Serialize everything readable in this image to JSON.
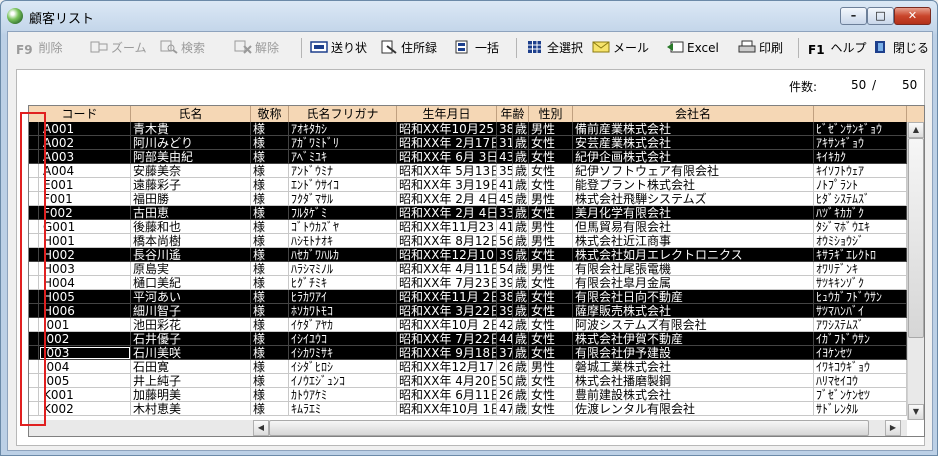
{
  "window": {
    "title": "顧客リスト",
    "minimize": "–",
    "maximize": "□",
    "close": "✕"
  },
  "toolbar": {
    "delete_key": "F9",
    "delete": "削除",
    "zoom": "ズーム",
    "search": "検索",
    "release": "解除",
    "invoice": "送り状",
    "address_book": "住所録",
    "batch": "一括",
    "select_all": "全選択",
    "mail": "メール",
    "excel": "Excel",
    "print": "印刷",
    "help_key": "F1",
    "help": "ヘルプ",
    "close": "閉じる"
  },
  "count": {
    "label": "件数:",
    "current": "50",
    "slash": "/",
    "total": "50"
  },
  "columns": [
    "コード",
    "氏名",
    "敬称",
    "氏名フリガナ",
    "生年月日",
    "年齢",
    "性別",
    "会社名",
    ""
  ],
  "rows": [
    {
      "code": "A001",
      "name": "青木貴",
      "honorific": "様",
      "kana": "ｱｵｷﾀｶｼ",
      "birth": "昭和XX年10月25日",
      "age": "38",
      "unit": "歳",
      "gender": "男性",
      "company": "備前産業株式会社",
      "company_kana": "ﾋﾞｾﾞﾝｻﾝｷﾞｮｳ",
      "selected": true
    },
    {
      "code": "A002",
      "name": "阿川みどり",
      "honorific": "様",
      "kana": "ｱｶﾞﾜﾐﾄﾞﾘ",
      "birth": "昭和XX年 2月17日",
      "age": "31",
      "unit": "歳",
      "gender": "女性",
      "company": "安芸産業株式会社",
      "company_kana": "ｱｷｻﾝｷﾞｮｳ",
      "selected": true
    },
    {
      "code": "A003",
      "name": "阿部美由紀",
      "honorific": "様",
      "kana": "ｱﾍﾞﾐﾕｷ",
      "birth": "昭和XX年 6月 3日",
      "age": "43",
      "unit": "歳",
      "gender": "女性",
      "company": "紀伊企画株式会社",
      "company_kana": "ｷｲｷｶｸ",
      "selected": true
    },
    {
      "code": "A004",
      "name": "安藤美奈",
      "honorific": "様",
      "kana": "ｱﾝﾄﾞｳﾐﾅ",
      "birth": "昭和XX年 5月13日",
      "age": "35",
      "unit": "歳",
      "gender": "女性",
      "company": "紀伊ソフトウェア有限会社",
      "company_kana": "ｷｲｿﾌﾄｳｪｱ",
      "selected": false
    },
    {
      "code": "E001",
      "name": "遠藤彩子",
      "honorific": "様",
      "kana": "ｴﾝﾄﾞｳｻｲｺ",
      "birth": "昭和XX年 3月19日",
      "age": "41",
      "unit": "歳",
      "gender": "女性",
      "company": "能登プラント株式会社",
      "company_kana": "ﾉﾄﾌﾟﾗﾝﾄ",
      "selected": false
    },
    {
      "code": "F001",
      "name": "福田勝",
      "honorific": "様",
      "kana": "ﾌｸﾀﾞﾏｻﾙ",
      "birth": "昭和XX年 2月 4日",
      "age": "45",
      "unit": "歳",
      "gender": "男性",
      "company": "株式会社飛騨システムズ",
      "company_kana": "ﾋﾀﾞｼｽﾃﾑｽﾞ",
      "selected": false
    },
    {
      "code": "F002",
      "name": "古田恵",
      "honorific": "様",
      "kana": "ﾌﾙﾀｹﾞﾐ",
      "birth": "昭和XX年 2月 4日",
      "age": "33",
      "unit": "歳",
      "gender": "女性",
      "company": "美月化学有限会社",
      "company_kana": "ﾊﾂﾞｷｶｶﾞｸ",
      "selected": true
    },
    {
      "code": "G001",
      "name": "後藤和也",
      "honorific": "様",
      "kana": "ｺﾞﾄｳｶｽﾞﾔ",
      "birth": "昭和XX年11月23日",
      "age": "41",
      "unit": "歳",
      "gender": "男性",
      "company": "但馬貿易有限会社",
      "company_kana": "ﾀｼﾞﾏﾎﾞｳｴｷ",
      "selected": false
    },
    {
      "code": "H001",
      "name": "橋本尚樹",
      "honorific": "様",
      "kana": "ﾊｼﾓﾄﾅｵｷ",
      "birth": "昭和XX年 8月12日",
      "age": "56",
      "unit": "歳",
      "gender": "男性",
      "company": "株式会社近江商事",
      "company_kana": "ｵｳﾐｼｮｳｼﾞ",
      "selected": false
    },
    {
      "code": "H002",
      "name": "長谷川遙",
      "honorific": "様",
      "kana": "ﾊｾｶﾞﾜﾊﾙｶ",
      "birth": "昭和XX年12月10日",
      "age": "39",
      "unit": "歳",
      "gender": "女性",
      "company": "株式会社如月エレクトロニクス",
      "company_kana": "ｷｻﾗｷﾞｴﾚｸﾄﾛ",
      "selected": true
    },
    {
      "code": "H003",
      "name": "原島実",
      "honorific": "様",
      "kana": "ﾊﾗｼﾏﾐﾉﾙ",
      "birth": "昭和XX年 4月11日",
      "age": "54",
      "unit": "歳",
      "gender": "男性",
      "company": "有限会社尾張電機",
      "company_kana": "ｵﾜﾘﾃﾞﾝｷ",
      "selected": false
    },
    {
      "code": "H004",
      "name": "樋口美紀",
      "honorific": "様",
      "kana": "ﾋｸﾞﾁﾐｷ",
      "birth": "昭和XX年 7月23日",
      "age": "39",
      "unit": "歳",
      "gender": "女性",
      "company": "有限会社皐月金属",
      "company_kana": "ｻﾂｷｷﾝｿﾞｸ",
      "selected": false
    },
    {
      "code": "H005",
      "name": "平河あい",
      "honorific": "様",
      "kana": "ﾋﾗｶﾜｱｲ",
      "birth": "昭和XX年11月 2日",
      "age": "38",
      "unit": "歳",
      "gender": "女性",
      "company": "有限会社日向不動産",
      "company_kana": "ﾋｭｳｶﾞﾌﾄﾞｳｻﾝ",
      "selected": true
    },
    {
      "code": "H006",
      "name": "細川智子",
      "honorific": "様",
      "kana": "ﾎｿｶﾜﾄﾓｺ",
      "birth": "昭和XX年 3月22日",
      "age": "39",
      "unit": "歳",
      "gender": "女性",
      "company": "薩摩販売株式会社",
      "company_kana": "ｻﾂﾏﾊﾝﾊﾞｲ",
      "selected": true
    },
    {
      "code": "I001",
      "name": "池田彩花",
      "honorific": "様",
      "kana": "ｲｹﾀﾞｱﾔｶ",
      "birth": "昭和XX年10月 2日",
      "age": "42",
      "unit": "歳",
      "gender": "女性",
      "company": "阿波システムズ有限会社",
      "company_kana": "ｱﾜｼｽﾃﾑｽﾞ",
      "selected": false
    },
    {
      "code": "I002",
      "name": "石井優子",
      "honorific": "様",
      "kana": "ｲｼｲﾕｳｺ",
      "birth": "昭和XX年 7月22日",
      "age": "44",
      "unit": "歳",
      "gender": "女性",
      "company": "株式会社伊賀不動産",
      "company_kana": "ｲｶﾞﾌﾄﾞｳｻﾝ",
      "selected": true
    },
    {
      "code": "I003",
      "name": "石川美咲",
      "honorific": "様",
      "kana": "ｲｼｶﾜﾐｻｷ",
      "birth": "昭和XX年 9月18日",
      "age": "37",
      "unit": "歳",
      "gender": "女性",
      "company": "有限会社伊予建設",
      "company_kana": "ｲﾖｹﾝｾﾂ",
      "selected": true,
      "focused": true
    },
    {
      "code": "I004",
      "name": "石田寛",
      "honorific": "様",
      "kana": "ｲｼﾀﾞﾋﾛｼ",
      "birth": "昭和XX年12月17日",
      "age": "26",
      "unit": "歳",
      "gender": "男性",
      "company": "磐城工業株式会社",
      "company_kana": "ｲﾜｷｺｳｷﾞｮｳ",
      "selected": false
    },
    {
      "code": "I005",
      "name": "井上純子",
      "honorific": "様",
      "kana": "ｲﾉｳｴｼﾞｭﾝｺ",
      "birth": "昭和XX年 4月20日",
      "age": "50",
      "unit": "歳",
      "gender": "女性",
      "company": "株式会社播磨製鋼",
      "company_kana": "ﾊﾘﾏｾｲｺｳ",
      "selected": false
    },
    {
      "code": "K001",
      "name": "加藤明美",
      "honorific": "様",
      "kana": "ｶﾄｳｱｹﾐ",
      "birth": "昭和XX年 6月11日",
      "age": "26",
      "unit": "歳",
      "gender": "女性",
      "company": "豊前建設株式会社",
      "company_kana": "ﾌﾞｾﾞﾝｹﾝｾﾂ",
      "selected": false
    },
    {
      "code": "K002",
      "name": "木村恵美",
      "honorific": "様",
      "kana": "ｷﾑﾗｴﾐ",
      "birth": "昭和XX年10月 1日",
      "age": "47",
      "unit": "歳",
      "gender": "女性",
      "company": "佐渡レンタル有限会社",
      "company_kana": "ｻﾄﾞﾚﾝﾀﾙ",
      "selected": false
    }
  ],
  "scroll": {
    "up": "▲",
    "down": "▼",
    "left": "◀",
    "right": "▶"
  }
}
